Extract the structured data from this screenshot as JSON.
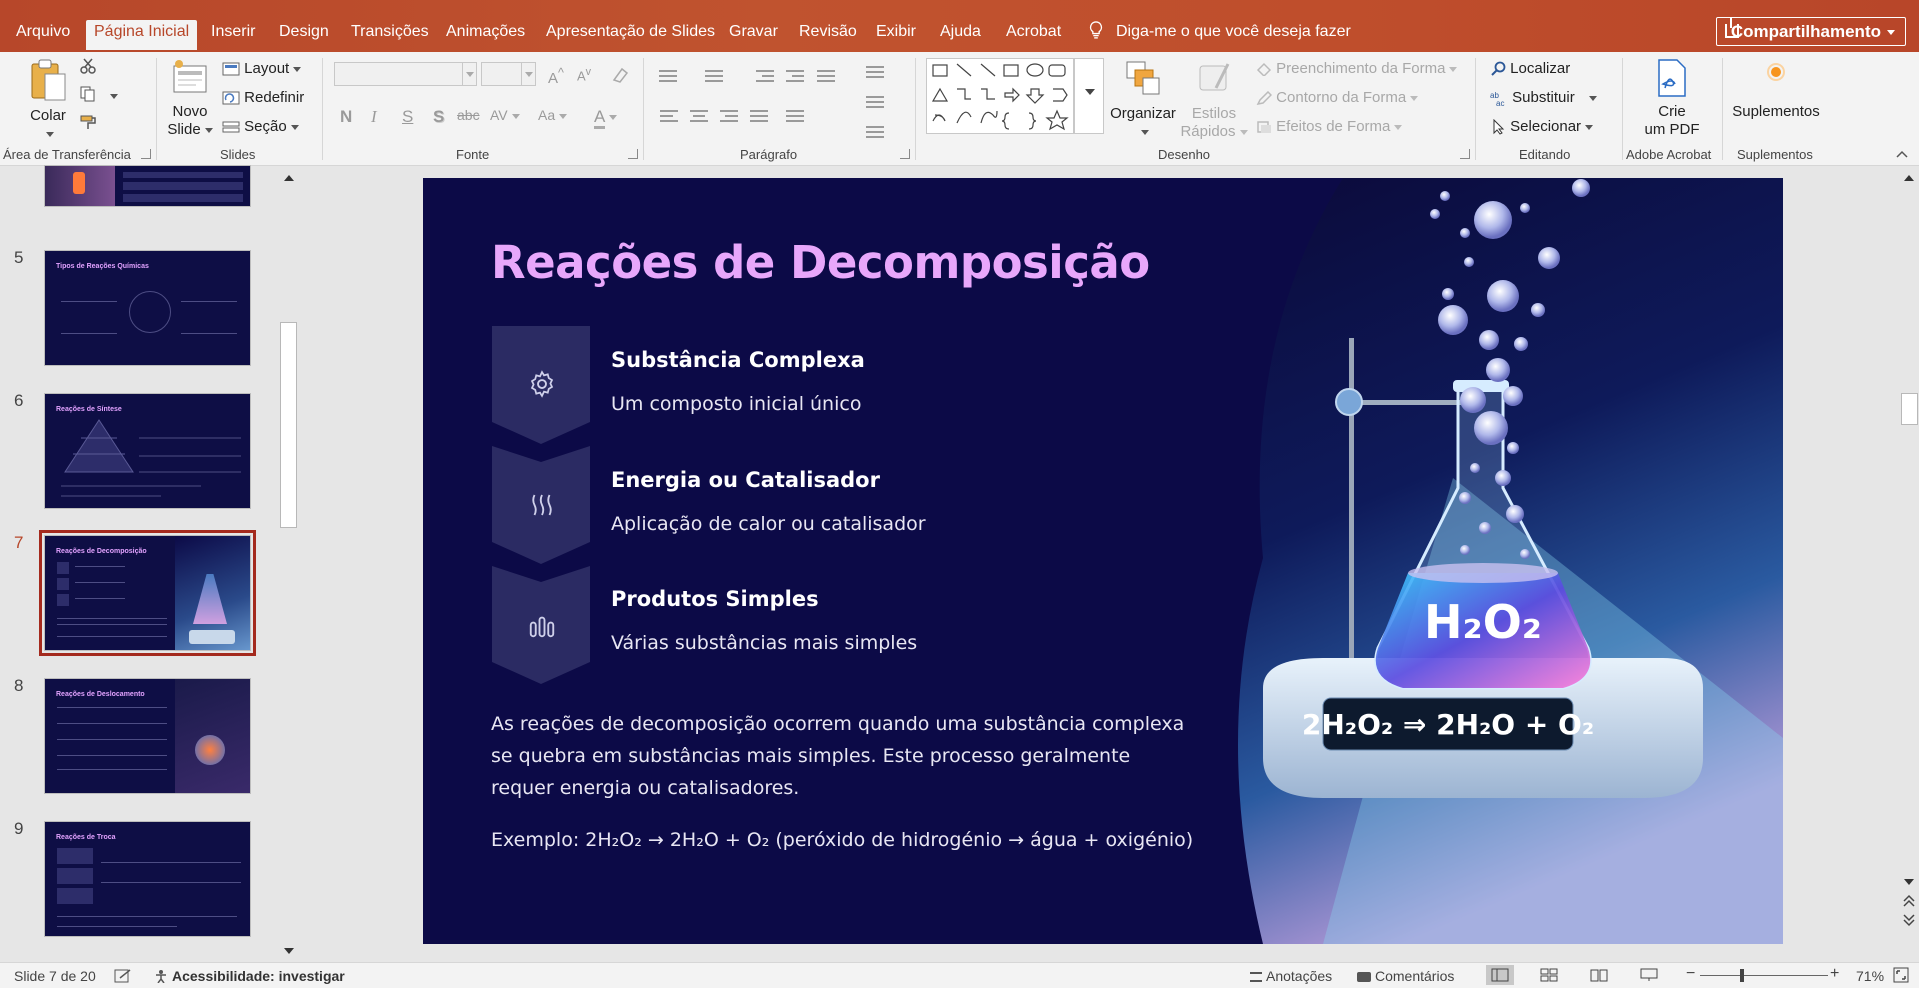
{
  "tabs": [
    {
      "label": "Arquivo",
      "active": false
    },
    {
      "label": "Página Inicial",
      "active": true
    },
    {
      "label": "Inserir",
      "active": false
    },
    {
      "label": "Design",
      "active": false
    },
    {
      "label": "Transições",
      "active": false
    },
    {
      "label": "Animações",
      "active": false
    },
    {
      "label": "Apresentação de Slides",
      "active": false
    },
    {
      "label": "Gravar",
      "active": false
    },
    {
      "label": "Revisão",
      "active": false
    },
    {
      "label": "Exibir",
      "active": false
    },
    {
      "label": "Ajuda",
      "active": false
    },
    {
      "label": "Acrobat",
      "active": false
    }
  ],
  "tell_me": "Diga-me o que você deseja fazer",
  "share_label": "Compartilhamento",
  "ribbon": {
    "clipboard": {
      "paste": "Colar",
      "group": "Área de Transferência"
    },
    "slides": {
      "new_slide_1": "Novo",
      "new_slide_2": "Slide",
      "layout": "Layout",
      "reset": "Redefinir",
      "section": "Seção",
      "group": "Slides"
    },
    "font": {
      "group": "Fonte",
      "bold": "N",
      "italic": "I",
      "underline": "S",
      "shadow": "S",
      "strike": "abc",
      "spacing": "AV",
      "case": "Aa",
      "color": "A"
    },
    "paragraph": {
      "group": "Parágrafo"
    },
    "drawing": {
      "arrange_1": "Organizar",
      "quick_styles_1": "Estilos",
      "quick_styles_2": "Rápidos",
      "shape_fill": "Preenchimento da Forma",
      "shape_outline": "Contorno da Forma",
      "shape_effects": "Efeitos de Forma",
      "group": "Desenho"
    },
    "editing": {
      "find": "Localizar",
      "replace": "Substituir",
      "select": "Selecionar",
      "group": "Editando"
    },
    "acrobat": {
      "create_pdf_1": "Crie",
      "create_pdf_2": "um PDF",
      "group": "Adobe Acrobat"
    },
    "addins": {
      "addins": "Suplementos",
      "group": "Suplementos"
    }
  },
  "thumbnails": [
    {
      "number": "",
      "title": ""
    },
    {
      "number": "5",
      "title": "Tipos de Reações Químicas"
    },
    {
      "number": "6",
      "title": "Reações de Síntese"
    },
    {
      "number": "7",
      "title": "Reações de Decomposição",
      "active": true
    },
    {
      "number": "8",
      "title": "Reações de Deslocamento"
    },
    {
      "number": "9",
      "title": "Reações de Troca"
    }
  ],
  "slide": {
    "title": "Reações de Decomposição",
    "items": [
      {
        "heading": "Substância Complexa",
        "sub": "Um composto inicial único",
        "icon": "gear-icon"
      },
      {
        "heading": "Energia ou Catalisador",
        "sub": "Aplicação de calor ou catalisador",
        "icon": "heat-waves-icon"
      },
      {
        "heading": "Produtos Simples",
        "sub": "Várias substâncias mais simples",
        "icon": "bar-columns-icon"
      }
    ],
    "body": "As reações de decomposição ocorrem quando uma substância complexa se quebra em substâncias mais simples. Este processo geralmente requer energia ou catalisadores.",
    "example": "Exemplo: 2H₂O₂ → 2H₂O + O₂ (peróxido de hidrogénio → água + oxigénio)",
    "flask_label": "H₂O₂",
    "display_label": "2H₂O₂ ⇒ 2H₂O + O₂"
  },
  "status": {
    "slide_counter": "Slide 7 de 20",
    "accessibility": "Acessibilidade: investigar",
    "notes": "Anotações",
    "comments": "Comentários",
    "zoom": "71%"
  },
  "colors": {
    "accent": "#b7472a",
    "slide_bg": "#0c0a47",
    "slide_title": "#e8a7fb"
  }
}
